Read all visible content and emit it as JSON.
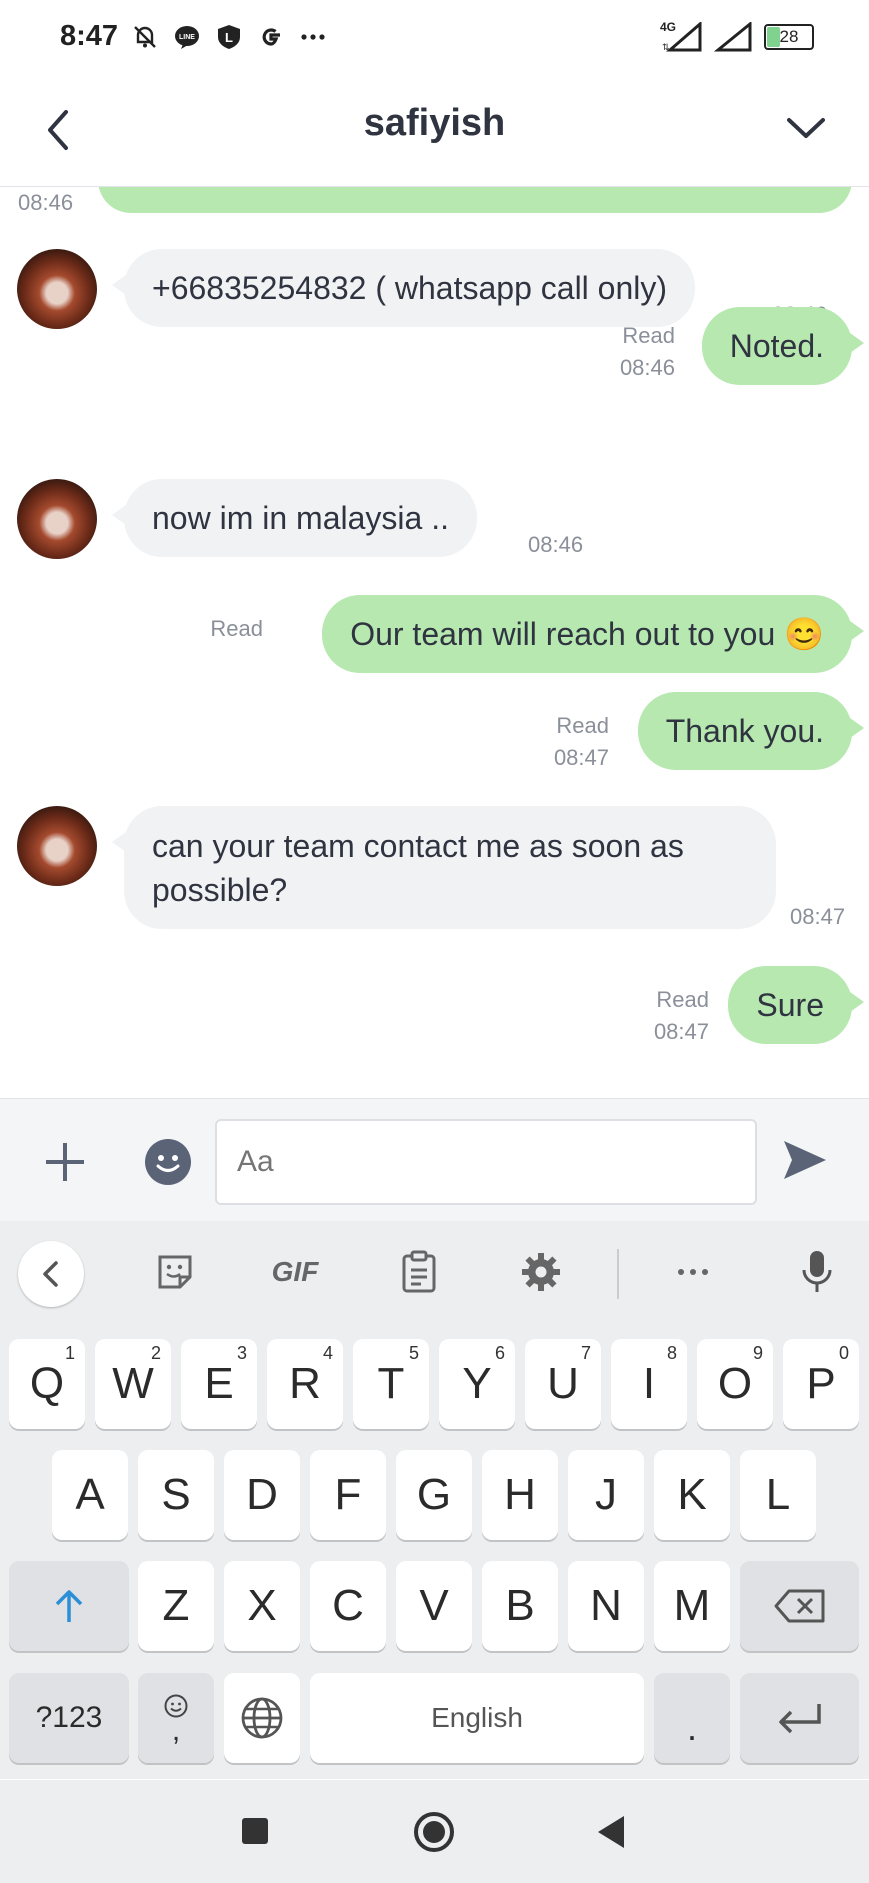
{
  "status_bar": {
    "time": "8:47",
    "network": "4G",
    "battery": "28"
  },
  "header": {
    "title": "safiyish"
  },
  "messages": [
    {
      "side": "out",
      "text": "",
      "time": "08:46"
    },
    {
      "side": "in",
      "text": "+66835254832 ( whatsapp call only)",
      "time": "08:46"
    },
    {
      "side": "out",
      "text": "Noted.",
      "read": "Read",
      "time": "08:46"
    },
    {
      "side": "in",
      "text": "now im in malaysia ..",
      "time": "08:46"
    },
    {
      "side": "out",
      "text": "Our team will reach out to you 😊",
      "read": "Read",
      "time": ""
    },
    {
      "side": "out",
      "text": "Thank you.",
      "read": "Read",
      "time": "08:47"
    },
    {
      "side": "in",
      "text": "can your team contact me as soon as possible?",
      "time": "08:47"
    },
    {
      "side": "out",
      "text": "Sure",
      "read": "Read",
      "time": "08:47"
    }
  ],
  "input": {
    "placeholder": "Aa"
  },
  "keyboard": {
    "toolbar": [
      "back",
      "sticker",
      "GIF",
      "clipboard",
      "settings",
      "more",
      "mic"
    ],
    "gif_label": "GIF",
    "row1": [
      [
        "Q",
        "1"
      ],
      [
        "W",
        "2"
      ],
      [
        "E",
        "3"
      ],
      [
        "R",
        "4"
      ],
      [
        "T",
        "5"
      ],
      [
        "Y",
        "6"
      ],
      [
        "U",
        "7"
      ],
      [
        "I",
        "8"
      ],
      [
        "O",
        "9"
      ],
      [
        "P",
        "0"
      ]
    ],
    "row2": [
      "A",
      "S",
      "D",
      "F",
      "G",
      "H",
      "J",
      "K",
      "L"
    ],
    "row3": [
      "Z",
      "X",
      "C",
      "V",
      "B",
      "N",
      "M"
    ],
    "symbols_label": "?123",
    "comma_label": ",",
    "space_label": "English",
    "period_label": "."
  },
  "colors": {
    "outgoing_bubble": "#b6e8b0",
    "incoming_bubble": "#f1f2f4",
    "accent": "#5b6477"
  }
}
